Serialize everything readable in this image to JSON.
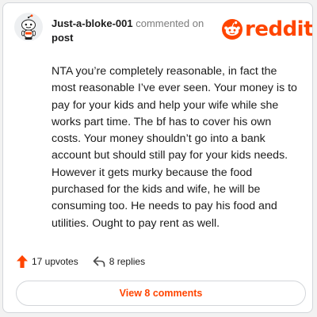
{
  "comment": {
    "username": "Just-a-bloke-001",
    "action_text": "commented on",
    "post_text": "post",
    "body": "NTA you’re completely reasonable, in fact the most reasonable I’ve ever seen. Your money is to pay for your kids and help your wife while she works part time. The bf has to cover his own costs. Your money shouldn’t go into a bank account but should still pay for your kids needs. However it gets murky because the food purchased for the kids and wife, he will be consuming too. He needs to pay his food and utilities. Ought to pay rent as well."
  },
  "brand": {
    "name": "reddit",
    "mark_icon": "reddit-snoo-icon",
    "color": "#ff4500"
  },
  "avatar": {
    "icon": "snoo-avatar-icon"
  },
  "actions": {
    "upvotes_label": "17 upvotes",
    "upvote_icon": "upvote-arrow-icon",
    "upvote_color": "#ff4500",
    "replies_label": "8 replies",
    "reply_icon": "reply-arrow-icon"
  },
  "footer": {
    "view_comments_label": "View 8 comments"
  }
}
